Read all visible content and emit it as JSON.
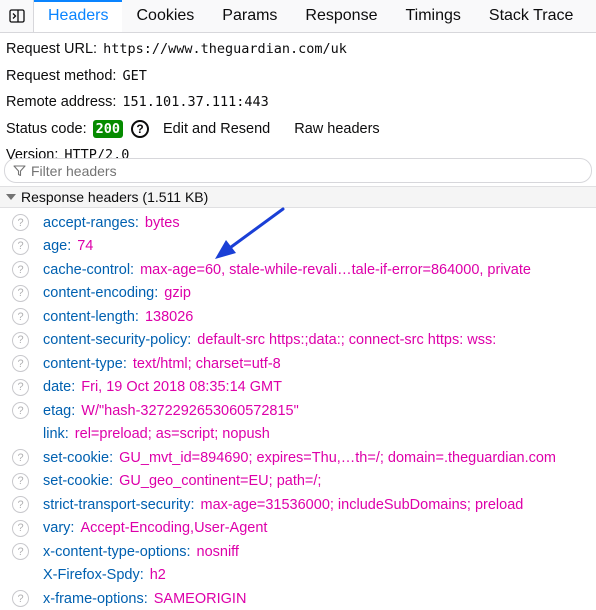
{
  "tabs": [
    {
      "label": "Headers",
      "active": true
    },
    {
      "label": "Cookies",
      "active": false
    },
    {
      "label": "Params",
      "active": false
    },
    {
      "label": "Response",
      "active": false
    },
    {
      "label": "Timings",
      "active": false
    },
    {
      "label": "Stack Trace",
      "active": false
    }
  ],
  "summary": {
    "request_url_label": "Request URL:",
    "request_url": "https://www.theguardian.com/uk",
    "request_method_label": "Request method:",
    "request_method": "GET",
    "remote_address_label": "Remote address:",
    "remote_address": "151.101.37.111:443",
    "status_code_label": "Status code:",
    "status_code": "200",
    "help_label": "?",
    "edit_resend_label": "Edit and Resend",
    "raw_headers_label": "Raw headers",
    "version_label": "Version:",
    "version": "HTTP/2.0"
  },
  "filter": {
    "placeholder": "Filter headers"
  },
  "response_section": {
    "label": "Response headers (1.511 KB)"
  },
  "headers": [
    {
      "name": "accept-ranges",
      "value": "bytes",
      "icon": true
    },
    {
      "name": "age",
      "value": "74",
      "icon": true
    },
    {
      "name": "cache-control",
      "value": "max-age=60, stale-while-revali…tale-if-error=864000, private",
      "icon": true
    },
    {
      "name": "content-encoding",
      "value": "gzip",
      "icon": true
    },
    {
      "name": "content-length",
      "value": "138026",
      "icon": true
    },
    {
      "name": "content-security-policy",
      "value": "default-src https:;data:; connect-src https: wss:",
      "icon": true
    },
    {
      "name": "content-type",
      "value": "text/html; charset=utf-8",
      "icon": true
    },
    {
      "name": "date",
      "value": "Fri, 19 Oct 2018 08:35:14 GMT",
      "icon": true
    },
    {
      "name": "etag",
      "value": "W/\"hash-3272292653060572815\"",
      "icon": true
    },
    {
      "name": "link",
      "value": "rel=preload; as=script; nopush",
      "icon": false
    },
    {
      "name": "set-cookie",
      "value": "GU_mvt_id=894690; expires=Thu,…th=/; domain=.theguardian.com",
      "icon": true
    },
    {
      "name": "set-cookie",
      "value": "GU_geo_continent=EU; path=/;",
      "icon": true
    },
    {
      "name": "strict-transport-security",
      "value": "max-age=31536000; includeSubDomains; preload",
      "icon": true
    },
    {
      "name": "vary",
      "value": "Accept-Encoding,User-Agent",
      "icon": true
    },
    {
      "name": "x-content-type-options",
      "value": "nosniff",
      "icon": true
    },
    {
      "name": "X-Firefox-Spdy",
      "value": "h2",
      "icon": false
    },
    {
      "name": "x-frame-options",
      "value": "SAMEORIGIN",
      "icon": true
    }
  ],
  "colors": {
    "accent": "#0a84ff",
    "header_name": "#0060b0",
    "header_value": "#dd00a9",
    "status_ok": "#058b00",
    "annotation_arrow": "#1a3fd6"
  },
  "icons": {
    "panel_toggle": "sidebar-toggle-icon",
    "filter": "filter-icon",
    "header_help": "question-circle-icon",
    "section_toggle": "triangle-down-icon"
  }
}
